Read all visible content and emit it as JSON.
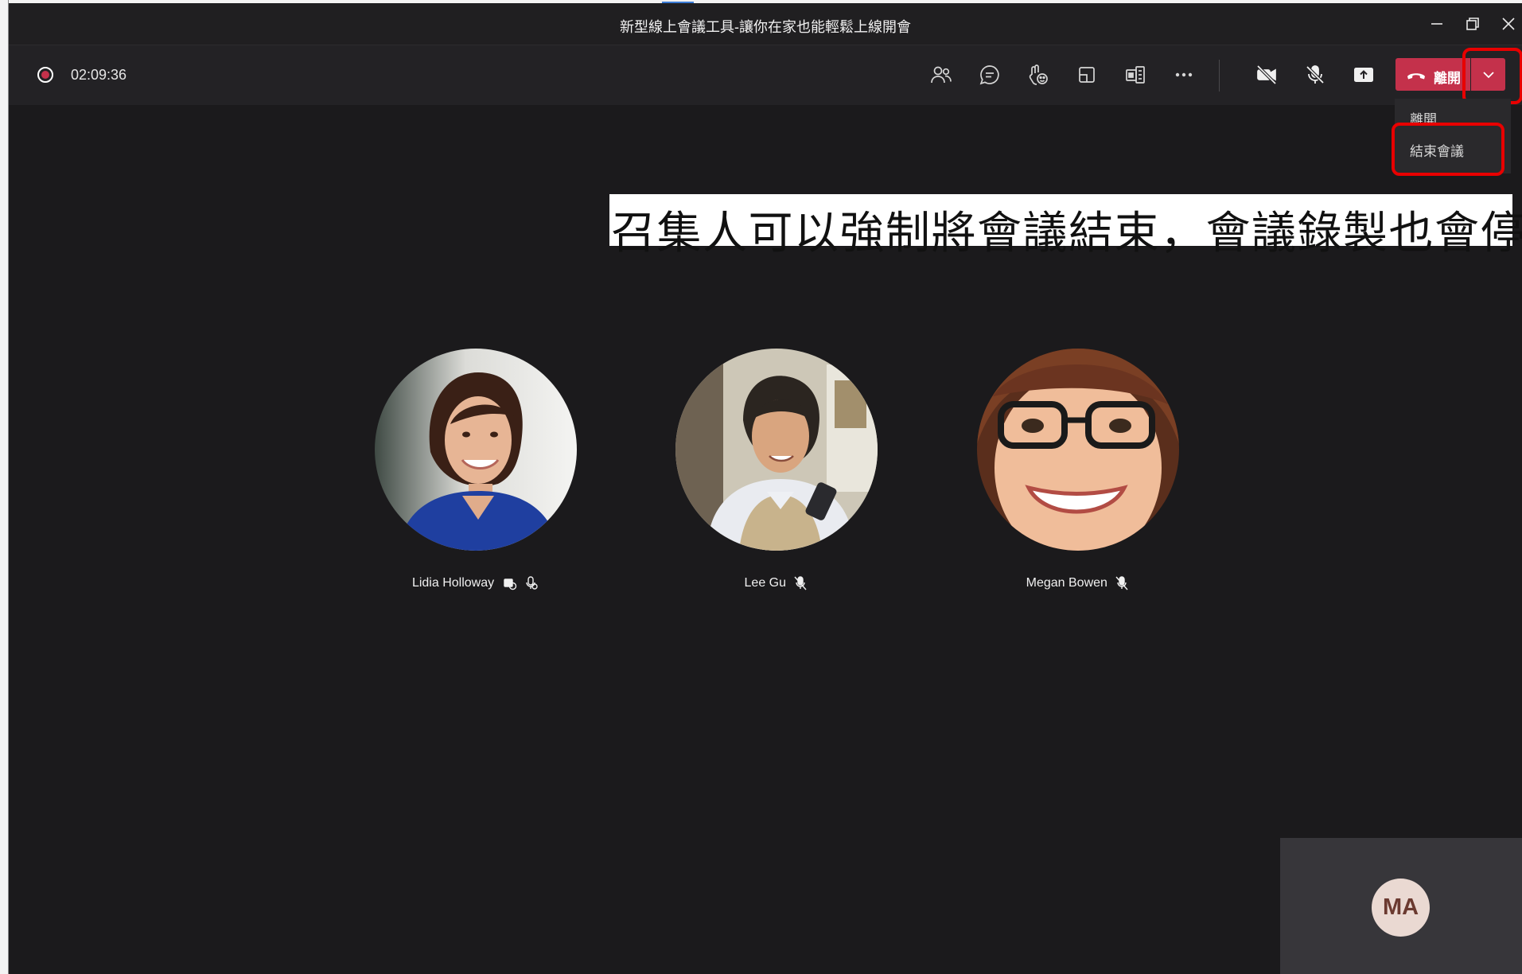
{
  "window": {
    "title": "新型線上會議工具-讓你在家也能輕鬆上線開會",
    "minimize_icon": "minimize-icon",
    "restore_icon": "restore-icon",
    "close_icon": "close-icon"
  },
  "toolbar": {
    "timer": "02:09:36",
    "recording_icon": "recording-indicator-icon",
    "buttons": [
      {
        "name": "participants",
        "icon": "people-icon"
      },
      {
        "name": "chat",
        "icon": "chat-icon"
      },
      {
        "name": "raise-hand",
        "icon": "raise-hand-icon"
      },
      {
        "name": "breakout-rooms",
        "icon": "breakout-rooms-icon"
      },
      {
        "name": "view",
        "icon": "view-icon"
      },
      {
        "name": "more-actions",
        "icon": "more-icon"
      },
      {
        "name": "camera",
        "icon": "camera-off-icon"
      },
      {
        "name": "mic",
        "icon": "mic-off-icon"
      },
      {
        "name": "share",
        "icon": "share-tray-icon"
      }
    ],
    "leave_label": "離開",
    "leave_color": "#c4314b"
  },
  "leave_menu": {
    "items": [
      {
        "label": "離開"
      },
      {
        "label": "結束會議"
      }
    ]
  },
  "caption": "召集人可以強制將會議結束，會議錄製也會停止",
  "participants": [
    {
      "name": "Lidia Holloway",
      "status_icons": [
        "raise-hand-icon",
        "mic-icon"
      ]
    },
    {
      "name": "Lee Gu",
      "status_icons": [
        "mic-off-icon"
      ]
    },
    {
      "name": "Megan Bowen",
      "status_icons": [
        "mic-off-icon"
      ]
    }
  ],
  "self": {
    "initials": "MA"
  },
  "colors": {
    "background": "#1b1a1c",
    "highlight": "#e80000",
    "leave": "#c4314b"
  }
}
